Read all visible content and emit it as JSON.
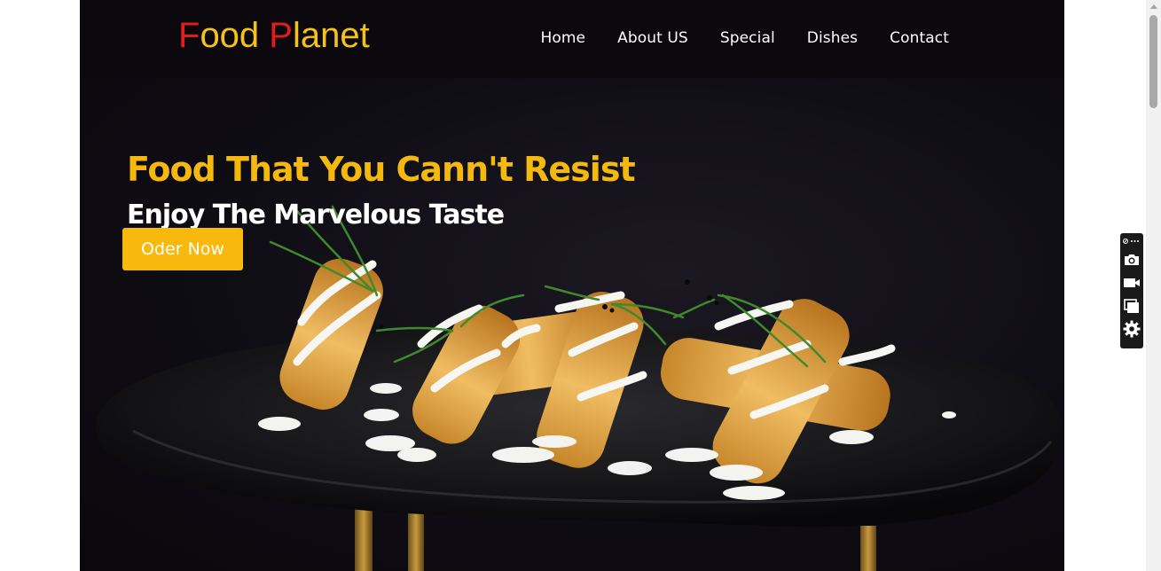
{
  "brand": {
    "first_initial": "F",
    "first_rest": "ood ",
    "second_initial": "P",
    "second_rest": "lanet"
  },
  "nav": {
    "items": [
      {
        "label": "Home"
      },
      {
        "label": "About US"
      },
      {
        "label": "Special"
      },
      {
        "label": "Dishes"
      },
      {
        "label": "Contact"
      }
    ]
  },
  "hero": {
    "title": "Food That You Cann't Resist",
    "subtitle": "Enjoy The Marvelous Taste",
    "cta_label": "Oder Now",
    "image_icon": "spring-rolls-photo"
  },
  "toolbar": {
    "items": [
      {
        "icon": "extension-menu-icon"
      },
      {
        "icon": "camera-icon"
      },
      {
        "icon": "video-camera-icon"
      },
      {
        "icon": "window-capture-icon"
      },
      {
        "icon": "gear-icon"
      }
    ]
  },
  "colors": {
    "brand_red": "#e21b1b",
    "brand_yellow": "#f5c21a",
    "accent_yellow": "#f8b80d",
    "nav_bg": "#0b090d"
  }
}
